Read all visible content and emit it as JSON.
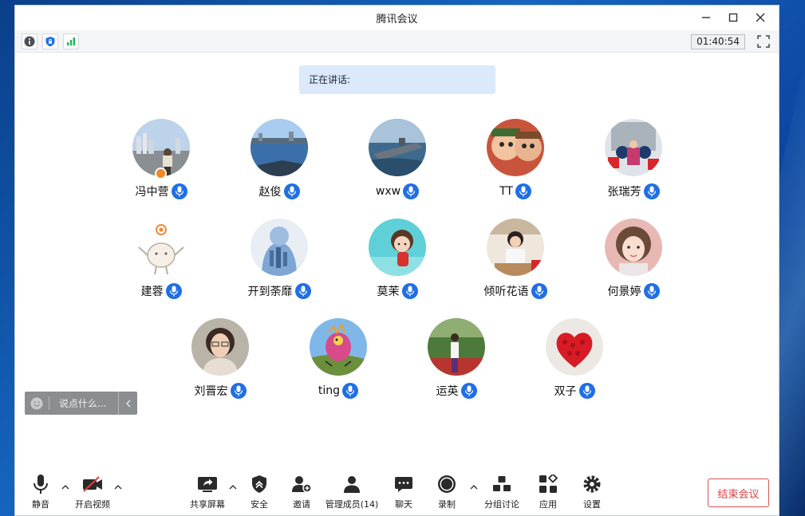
{
  "window": {
    "title": "腾讯会议"
  },
  "statusbar": {
    "timer": "01:40:54"
  },
  "speaking": {
    "label": "正在讲话:"
  },
  "participants": [
    {
      "name": "冯中营",
      "avatar": "photo-city-waterfront",
      "host": true
    },
    {
      "name": "赵俊",
      "avatar": "photo-lake-city"
    },
    {
      "name": "wxw",
      "avatar": "photo-aircraft-carrier"
    },
    {
      "name": "TT",
      "avatar": "cartoon-faces"
    },
    {
      "name": "张瑞芳",
      "avatar": "photo-festive"
    },
    {
      "name": "建蓉",
      "avatar": "doodle-character"
    },
    {
      "name": "开到荼靡",
      "avatar": "photo-double-exposure"
    },
    {
      "name": "莫茉",
      "avatar": "cartoon-girl"
    },
    {
      "name": "倾听花语",
      "avatar": "photo-woman-desk"
    },
    {
      "name": "何景婷",
      "avatar": "illustration-girl"
    },
    {
      "name": "刘晋宏",
      "avatar": "photo-woman-glasses"
    },
    {
      "name": "ting",
      "avatar": "drawing-colorful"
    },
    {
      "name": "运英",
      "avatar": "photo-outdoor-person"
    },
    {
      "name": "双子",
      "avatar": "red-heart-roses"
    }
  ],
  "chat": {
    "placeholder": "说点什么..."
  },
  "toolbar": {
    "mute": "静音",
    "video": "开启视频",
    "share": "共享屏幕",
    "security": "安全",
    "invite": "邀请",
    "members": "管理成员(14)",
    "chat": "聊天",
    "record": "录制",
    "breakout": "分组讨论",
    "apps": "应用",
    "settings": "设置",
    "end": "结束会议"
  },
  "colors": {
    "accent": "#1f6fe5",
    "danger": "#e04040",
    "speaking_bg": "#dbe9fb"
  }
}
